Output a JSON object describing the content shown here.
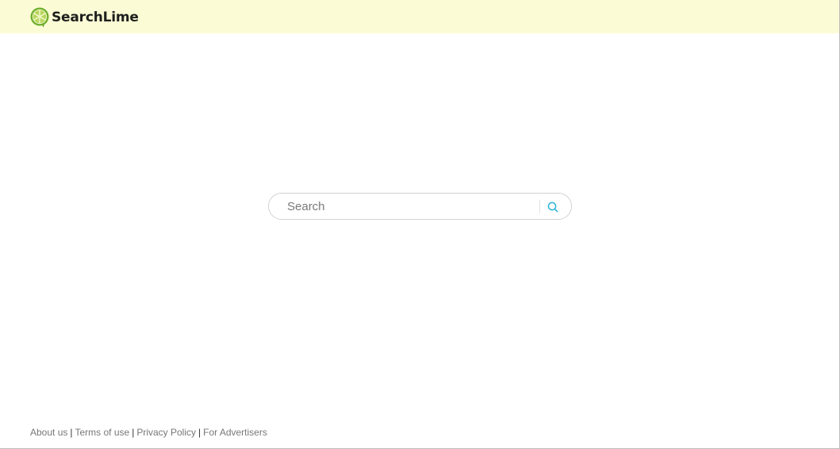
{
  "brand": {
    "name": "SearchLime",
    "icon": "lime-slice-icon",
    "colors": {
      "header_bg": "#fbfcd5",
      "lime_green": "#6fae2e",
      "search_icon": "#2bb3d9"
    }
  },
  "search": {
    "placeholder": "Search",
    "value": "",
    "button_icon": "search-icon"
  },
  "footer": {
    "links": [
      {
        "label": "About us"
      },
      {
        "label": "Terms of use"
      },
      {
        "label": "Privacy Policy"
      },
      {
        "label": "For Advertisers"
      }
    ],
    "separator": "|"
  }
}
